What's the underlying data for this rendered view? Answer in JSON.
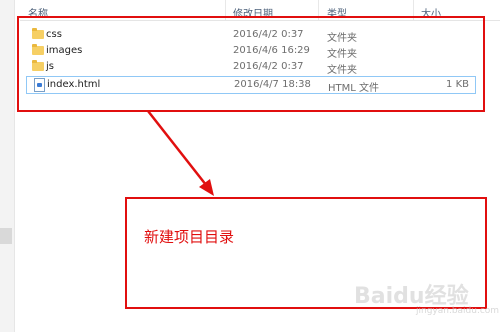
{
  "header": {
    "col_name": "名称",
    "col_modified": "修改日期",
    "col_type": "类型",
    "col_size": "大小"
  },
  "files": [
    {
      "name": "css",
      "modified": "2016/4/2 0:37",
      "type": "文件夹",
      "size": "",
      "icon": "folder-icon"
    },
    {
      "name": "images",
      "modified": "2016/4/6 16:29",
      "type": "文件夹",
      "size": "",
      "icon": "folder-icon"
    },
    {
      "name": "js",
      "modified": "2016/4/2 0:37",
      "type": "文件夹",
      "size": "",
      "icon": "folder-icon"
    },
    {
      "name": "index.html",
      "modified": "2016/4/7 18:38",
      "type": "HTML 文件",
      "size": "1 KB",
      "icon": "html-file-icon"
    }
  ],
  "annotation": {
    "text": "新建项目目录",
    "color": "#e10f0f"
  },
  "watermark": {
    "text": "Baidu经验",
    "sub": "jingyan.baidu.com"
  }
}
